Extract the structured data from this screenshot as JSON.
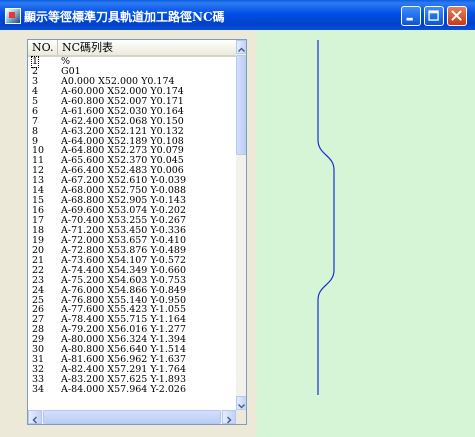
{
  "window": {
    "title": "顯示等徑標準刀具軌道加工路徑NC碼",
    "controls": {
      "minimize": "minimize",
      "maximize": "maximize",
      "close": "close"
    }
  },
  "list": {
    "columns": [
      "NO.",
      "NC碼列表"
    ],
    "rows": [
      {
        "no": "1",
        "code": "%"
      },
      {
        "no": "2",
        "code": "G01"
      },
      {
        "no": "3",
        "code": "A0.000 X52.000 Y0.174"
      },
      {
        "no": "4",
        "code": "A-60.000 X52.000 Y0.174"
      },
      {
        "no": "5",
        "code": "A-60.800 X52.007 Y0.171"
      },
      {
        "no": "6",
        "code": "A-61.600 X52.030 Y0.164"
      },
      {
        "no": "7",
        "code": "A-62.400 X52.068 Y0.150"
      },
      {
        "no": "8",
        "code": "A-63.200 X52.121 Y0.132"
      },
      {
        "no": "9",
        "code": "A-64.000 X52.189 Y0.108"
      },
      {
        "no": "10",
        "code": "A-64.800 X52.273 Y0.079"
      },
      {
        "no": "11",
        "code": "A-65.600 X52.370 Y0.045"
      },
      {
        "no": "12",
        "code": "A-66.400 X52.483 Y0.006"
      },
      {
        "no": "13",
        "code": "A-67.200 X52.610 Y-0.039"
      },
      {
        "no": "14",
        "code": "A-68.000 X52.750 Y-0.088"
      },
      {
        "no": "15",
        "code": "A-68.800 X52.905 Y-0.143"
      },
      {
        "no": "16",
        "code": "A-69.600 X53.074 Y-0.202"
      },
      {
        "no": "17",
        "code": "A-70.400 X53.255 Y-0.267"
      },
      {
        "no": "18",
        "code": "A-71.200 X53.450 Y-0.336"
      },
      {
        "no": "19",
        "code": "A-72.000 X53.657 Y-0.410"
      },
      {
        "no": "20",
        "code": "A-72.800 X53.876 Y-0.489"
      },
      {
        "no": "21",
        "code": "A-73.600 X54.107 Y-0.572"
      },
      {
        "no": "22",
        "code": "A-74.400 X54.349 Y-0.660"
      },
      {
        "no": "23",
        "code": "A-75.200 X54.603 Y-0.753"
      },
      {
        "no": "24",
        "code": "A-76.000 X54.866 Y-0.849"
      },
      {
        "no": "25",
        "code": "A-76.800 X55.140 Y-0.950"
      },
      {
        "no": "26",
        "code": "A-77.600 X55.423 Y-1.055"
      },
      {
        "no": "27",
        "code": "A-78.400 X55.715 Y-1.164"
      },
      {
        "no": "28",
        "code": "A-79.200 X56.016 Y-1.277"
      },
      {
        "no": "29",
        "code": "A-80.000 X56.324 Y-1.394"
      },
      {
        "no": "30",
        "code": "A-80.800 X56.640 Y-1.514"
      },
      {
        "no": "31",
        "code": "A-81.600 X56.962 Y-1.637"
      },
      {
        "no": "32",
        "code": "A-82.400 X57.291 Y-1.764"
      },
      {
        "no": "33",
        "code": "A-83.200 X57.625 Y-1.893"
      },
      {
        "no": "34",
        "code": "A-84.000 X57.964 Y-2.026"
      }
    ]
  },
  "colors": {
    "titlebar": "#0054e3",
    "canvas_bg": "#d6f5d6",
    "path_line": "#1a2fd6"
  },
  "icons": {
    "app": "app-icon",
    "scroll_up": "chevron-up-icon",
    "scroll_down": "chevron-down-icon",
    "scroll_left": "chevron-left-icon",
    "scroll_right": "chevron-right-icon"
  }
}
